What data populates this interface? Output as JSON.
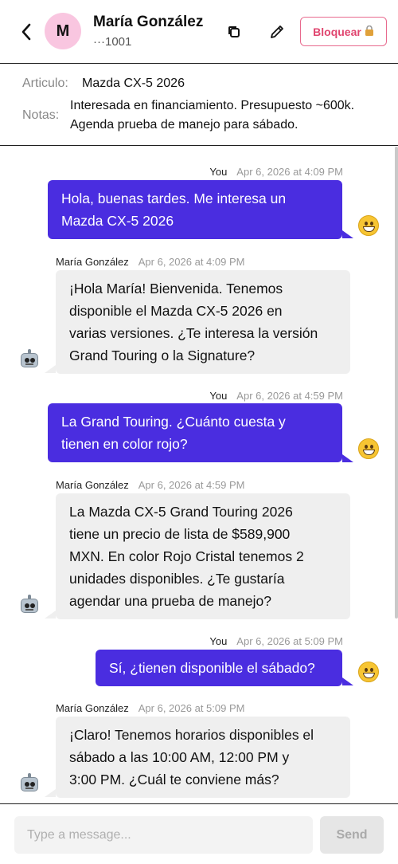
{
  "header": {
    "back_icon": "chevron-left-icon",
    "avatar_initial": "M",
    "contact_name": "María González",
    "contact_phone": "···1001",
    "copy_icon": "copy-icon",
    "edit_icon": "pencil-icon",
    "block_label": "Bloquear",
    "block_icon": "lock-icon"
  },
  "info": {
    "article_label": "Articulo:",
    "article_value": "Mazda CX-5 2026",
    "notes_label": "Notas:",
    "notes_line1": "Interesada en financiamiento. Presupuesto ~600k.",
    "notes_line2": "Agenda prueba de manejo para sábado."
  },
  "messages": [
    {
      "sender": "You",
      "time": "Apr 6, 2026 at 4:09 PM",
      "lines": [
        "Hola, buenas tardes. Me interesa un",
        "Mazda CX-5 2026"
      ],
      "avatar": "grinning-face-icon"
    },
    {
      "sender": "María González",
      "time": "Apr 6, 2026 at 4:09 PM",
      "lines": [
        "¡Hola María! Bienvenida. Tenemos",
        "disponible el Mazda CX-5 2026 en",
        "varias versiones. ¿Te interesa la versión",
        "Grand Touring o la Signature?"
      ],
      "avatar": "robot-icon"
    },
    {
      "sender": "You",
      "time": "Apr 6, 2026 at 4:59 PM",
      "lines": [
        "La Grand Touring. ¿Cuánto cuesta y",
        "tienen en color rojo?"
      ],
      "avatar": "grinning-face-icon"
    },
    {
      "sender": "María González",
      "time": "Apr 6, 2026 at 4:59 PM",
      "lines": [
        "La Mazda CX-5 Grand Touring 2026",
        "tiene un precio de lista de $589,900",
        "MXN. En color Rojo Cristal tenemos 2",
        "unidades disponibles. ¿Te gustaría",
        "agendar una prueba de manejo?"
      ],
      "avatar": "robot-icon"
    },
    {
      "sender": "You",
      "time": "Apr 6, 2026 at 5:09 PM",
      "lines": [
        "Sí, ¿tienen disponible el sábado?"
      ],
      "avatar": "grinning-face-icon"
    },
    {
      "sender": "María González",
      "time": "Apr 6, 2026 at 5:09 PM",
      "lines": [
        "¡Claro! Tenemos horarios disponibles el",
        "sábado a las 10:00 AM, 12:00 PM y",
        "3:00 PM. ¿Cuál te conviene más?"
      ],
      "avatar": "robot-icon"
    }
  ],
  "composer": {
    "placeholder": "Type a message...",
    "send_label": "Send"
  },
  "colors": {
    "outgoing_bubble": "#4a2de0",
    "incoming_bubble": "#efefef",
    "block_accent": "#e0456f",
    "avatar_bg": "#f9c6e0"
  }
}
